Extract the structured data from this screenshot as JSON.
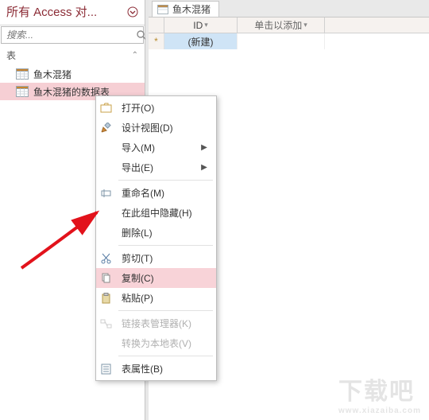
{
  "sidebar": {
    "title": "所有 Access 对...",
    "search_placeholder": "搜索...",
    "group_label": "表",
    "items": [
      {
        "label": "鱼木混猪"
      },
      {
        "label": "鱼木混猪的数据表"
      }
    ]
  },
  "tab": {
    "title": "鱼木混猪"
  },
  "datasheet": {
    "id_header": "ID",
    "add_header": "单击以添加",
    "new_row_label": "(新建)"
  },
  "context_menu": {
    "open": "打开(O)",
    "design_view": "设计视图(D)",
    "import": "导入(M)",
    "export": "导出(E)",
    "rename": "重命名(M)",
    "hide_in_group": "在此组中隐藏(H)",
    "delete": "删除(L)",
    "cut": "剪切(T)",
    "copy": "复制(C)",
    "paste": "粘贴(P)",
    "linked_table_manager": "链接表管理器(K)",
    "convert_to_local": "转换为本地表(V)",
    "table_properties": "表属性(B)"
  },
  "watermark": {
    "main": "下载吧",
    "sub": "www.xiazaiba.com"
  }
}
